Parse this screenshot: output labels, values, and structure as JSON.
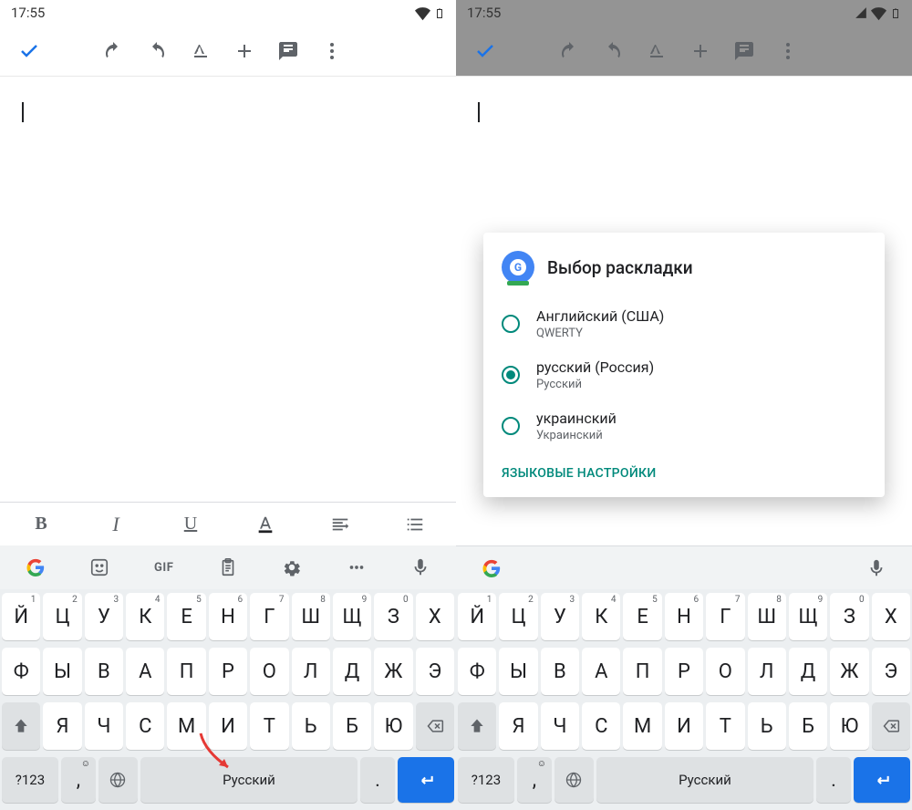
{
  "status": {
    "time": "17:55"
  },
  "format": {
    "bold": "B",
    "italic": "I",
    "underline": "U"
  },
  "suggestion": {
    "gif": "GIF"
  },
  "keyboard": {
    "row1": [
      {
        "ch": "Й",
        "n": "1"
      },
      {
        "ch": "Ц",
        "n": "2"
      },
      {
        "ch": "У",
        "n": "3"
      },
      {
        "ch": "К",
        "n": "4"
      },
      {
        "ch": "Е",
        "n": "5"
      },
      {
        "ch": "Н",
        "n": "6"
      },
      {
        "ch": "Г",
        "n": "7"
      },
      {
        "ch": "Ш",
        "n": "8"
      },
      {
        "ch": "Щ",
        "n": "9"
      },
      {
        "ch": "З",
        "n": "0"
      },
      {
        "ch": "Х",
        "n": ""
      }
    ],
    "row2": [
      {
        "ch": "Ф"
      },
      {
        "ch": "Ы"
      },
      {
        "ch": "В"
      },
      {
        "ch": "А"
      },
      {
        "ch": "П"
      },
      {
        "ch": "Р"
      },
      {
        "ch": "О"
      },
      {
        "ch": "Л"
      },
      {
        "ch": "Д"
      },
      {
        "ch": "Ж"
      },
      {
        "ch": "Э"
      }
    ],
    "row3": [
      {
        "ch": "Я"
      },
      {
        "ch": "Ч"
      },
      {
        "ch": "С"
      },
      {
        "ch": "М"
      },
      {
        "ch": "И"
      },
      {
        "ch": "Т"
      },
      {
        "ch": "Ь"
      },
      {
        "ch": "Б"
      },
      {
        "ch": "Ю"
      }
    ],
    "sym": "?123",
    "comma": ",",
    "space": "Русский",
    "dot": "."
  },
  "dialog": {
    "title": "Выбор раскладки",
    "options": [
      {
        "primary": "Английский (США)",
        "secondary": "QWERTY",
        "selected": false
      },
      {
        "primary": "русский (Россия)",
        "secondary": "Русский",
        "selected": true
      },
      {
        "primary": "украинский",
        "secondary": "Украинский",
        "selected": false
      }
    ],
    "link": "ЯЗЫКОВЫЕ НАСТРОЙКИ"
  }
}
